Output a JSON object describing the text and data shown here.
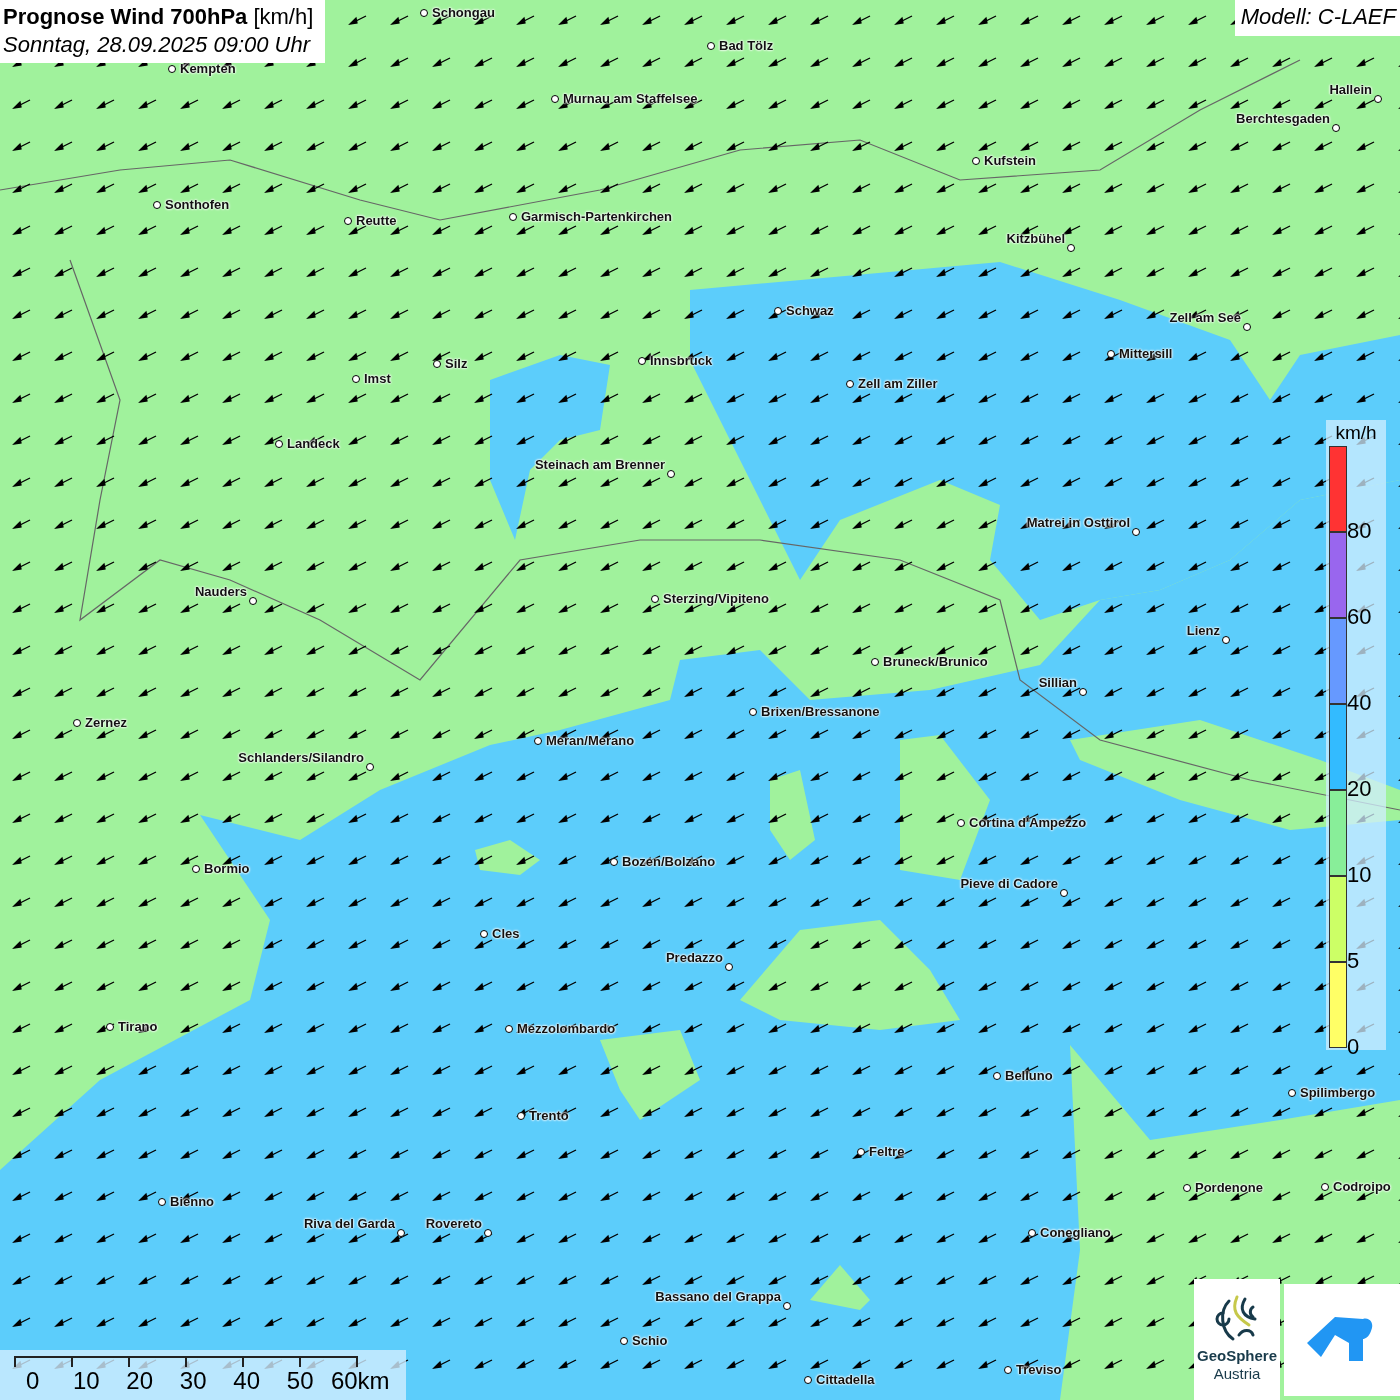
{
  "title": "**Prognose Wind 700hPa** [km/h]",
  "subtitle": "Sonntag, 28.09.2025 09:00 Uhr",
  "model": "Modell: C-LAEF",
  "cities": [
    {
      "name": "Schongau"
    },
    {
      "name": "Bad Tölz"
    },
    {
      "name": "Kempten"
    },
    {
      "name": "Murnau am Staffelsee"
    },
    {
      "name": "Hallein"
    },
    {
      "name": "Berchtesgaden"
    },
    {
      "name": "Kufstein"
    },
    {
      "name": "Sonthofen"
    },
    {
      "name": "Reutte"
    },
    {
      "name": "Garmisch-Partenkirchen"
    },
    {
      "name": "Kitzbühel"
    },
    {
      "name": "Schwaz"
    },
    {
      "name": "Zell am See"
    },
    {
      "name": "Mittersill"
    },
    {
      "name": "Innsbruck"
    },
    {
      "name": "Silz"
    },
    {
      "name": "Imst"
    },
    {
      "name": "Zell am Ziller"
    },
    {
      "name": "Landeck"
    },
    {
      "name": "Steinach am Brenner"
    },
    {
      "name": "Matrei in Osttirol"
    },
    {
      "name": "Nauders"
    },
    {
      "name": "Sterzing/Vipiteno"
    },
    {
      "name": "Lienz"
    },
    {
      "name": "Bruneck/Brunico"
    },
    {
      "name": "Sillian"
    },
    {
      "name": "Brixen/Bressanone"
    },
    {
      "name": "Zernez"
    },
    {
      "name": "Meran/Merano"
    },
    {
      "name": "Schlanders/Silandro"
    },
    {
      "name": "Cortina d'Ampezzo"
    },
    {
      "name": "Bozen/Bolzano"
    },
    {
      "name": "Bormio"
    },
    {
      "name": "Pieve di Cadore"
    },
    {
      "name": "Cles"
    },
    {
      "name": "Predazzo"
    },
    {
      "name": "Tirano"
    },
    {
      "name": "Mezzolombardo"
    },
    {
      "name": "Belluno"
    },
    {
      "name": "Spilimbergo"
    },
    {
      "name": "Trento"
    },
    {
      "name": "Feltre"
    },
    {
      "name": "Pordenone"
    },
    {
      "name": "Codroipo"
    },
    {
      "name": "Bienno"
    },
    {
      "name": "Riva del Garda"
    },
    {
      "name": "Rovereto"
    },
    {
      "name": "Conegliano"
    },
    {
      "name": "Bassano del Grappa"
    },
    {
      "name": "Schio"
    },
    {
      "name": "Treviso"
    },
    {
      "name": "Cittadella"
    }
  ],
  "legend": {
    "unit": "km/h",
    "steps": [
      {
        "label": "80",
        "color": "#ff3333"
      },
      {
        "label": "60",
        "color": "#9966ee"
      },
      {
        "label": "40",
        "color": "#6699ff"
      },
      {
        "label": "20",
        "color": "#33bbff"
      },
      {
        "label": "10",
        "color": "#88ee99"
      },
      {
        "label": "5",
        "color": "#ccff66"
      },
      {
        "label": "0",
        "color": "#ffff66"
      }
    ]
  },
  "scale_bar": {
    "labels": [
      "0",
      "10",
      "20",
      "30",
      "40",
      "50",
      "60km"
    ]
  },
  "logo": {
    "name": "GeoSphere",
    "subname": "Austria"
  }
}
